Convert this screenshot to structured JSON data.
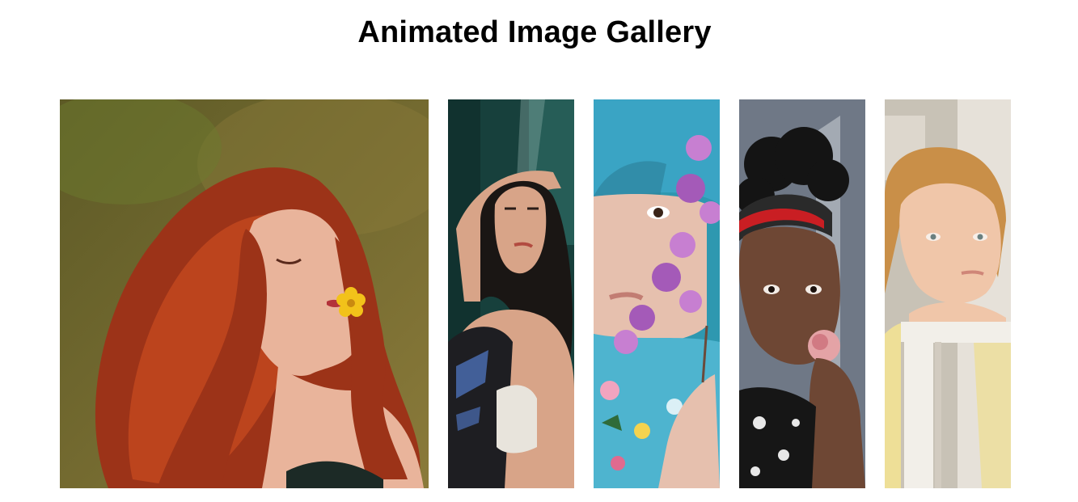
{
  "page": {
    "title": "Animated Image Gallery"
  },
  "gallery": {
    "images": [
      {
        "subject": "red-haired woman with closed eyes holding a yellow flower in her mouth",
        "state": "expanded",
        "colors": {
          "bg": "#5d5a26",
          "bg2": "#8a7a3a",
          "hair": "#9c3318",
          "hair2": "#c4481f",
          "skin": "#e9b49b",
          "accent": "#f2c21a"
        }
      },
      {
        "subject": "dark-haired woman with hand raised above her head against teal wall",
        "state": "collapsed",
        "colors": {
          "bg": "#17403c",
          "bg2": "#2d6a62",
          "hair": "#1a1614",
          "skin": "#d8a488",
          "shirt": "#1e1e22",
          "accent": "#e8e4dc"
        }
      },
      {
        "subject": "woman with teal bangs holding purple flowers in front of her face",
        "state": "collapsed",
        "colors": {
          "bg": "#2e98b0",
          "hair": "#3aa4c4",
          "skin": "#e6c0ae",
          "shirt": "#4eb4cf",
          "accent": "#a45ab8",
          "accent2": "#c77fd1"
        }
      },
      {
        "subject": "woman with curly hair and headscarf smelling a pink rose",
        "state": "collapsed",
        "colors": {
          "bg": "#6f7886",
          "bg2": "#a3aab3",
          "hair": "#141414",
          "skin": "#6e4734",
          "band": "#c91e23",
          "accent": "#e4a3a6"
        }
      },
      {
        "subject": "freckled ginger woman resting chin on white wooden frame",
        "state": "collapsed",
        "colors": {
          "bg": "#c8c2b6",
          "bg2": "#e6e1d9",
          "hair": "#c98f48",
          "skin": "#f0c6a9",
          "shirt": "#eedf97",
          "accent": "#f2efe9"
        }
      }
    ]
  }
}
